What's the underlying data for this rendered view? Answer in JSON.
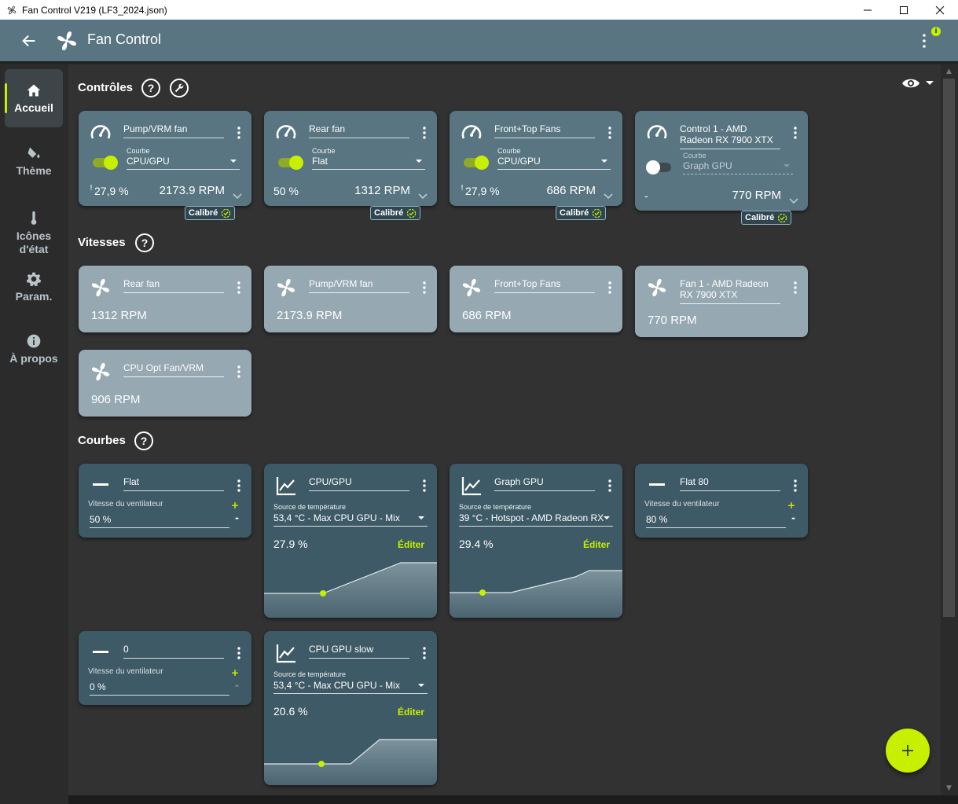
{
  "window": {
    "title": "Fan Control V219 (LF3_2024.json)"
  },
  "appbar": {
    "title": "Fan Control",
    "info_badge": "i"
  },
  "sidebar": {
    "items": [
      {
        "label": "Accueil",
        "icon": "home-icon",
        "active": true
      },
      {
        "label": "Thème",
        "icon": "paint-bucket-icon",
        "active": false
      },
      {
        "label": "Icônes d'état",
        "icon": "thermometer-icon",
        "active": false
      },
      {
        "label": "Param.",
        "icon": "gear-icon",
        "active": false
      },
      {
        "label": "À propos",
        "icon": "info-icon",
        "active": false
      }
    ]
  },
  "sections": {
    "controls": "Contrôles",
    "speeds": "Vitesses",
    "curves": "Courbes",
    "help_symbol": "?"
  },
  "controls": [
    {
      "name": "Pump/VRM fan",
      "curve_label": "Courbe",
      "curve": "CPU/GPU",
      "enabled": true,
      "percent": "27,9 %",
      "warning": "!",
      "rpm": "2173.9 RPM",
      "badge": "Calibré"
    },
    {
      "name": "Rear fan",
      "curve_label": "Courbe",
      "curve": "Flat",
      "enabled": true,
      "percent": "50 %",
      "warning": "",
      "rpm": "1312 RPM",
      "badge": "Calibré"
    },
    {
      "name": "Front+Top Fans",
      "curve_label": "Courbe",
      "curve": "CPU/GPU",
      "enabled": true,
      "percent": "27,9 %",
      "warning": "!",
      "rpm": "686 RPM",
      "badge": "Calibré"
    },
    {
      "name": "Control 1 - AMD Radeon RX 7900 XTX",
      "curve_label": "Courbe",
      "curve": "Graph GPU",
      "enabled": false,
      "percent": "-",
      "warning": "",
      "rpm": "770 RPM",
      "badge": "Calibré"
    }
  ],
  "speeds": [
    {
      "name": "Rear fan",
      "rpm": "1312 RPM"
    },
    {
      "name": "Pump/VRM fan",
      "rpm": "2173.9 RPM"
    },
    {
      "name": "Front+Top Fans",
      "rpm": "686 RPM"
    },
    {
      "name": "Fan 1 - AMD Radeon RX 7900 XTX",
      "rpm": "770 RPM"
    },
    {
      "name": "CPU Opt Fan/VRM",
      "rpm": "906 RPM"
    }
  ],
  "curves": {
    "flat": {
      "name": "Flat",
      "label": "Vitesse du ventilateur",
      "value": "50 %"
    },
    "cpugpu": {
      "name": "CPU/GPU",
      "source_label": "Source de température",
      "source": "53,4 °C - Max CPU GPU - Mix",
      "percent": "27.9 %",
      "edit": "Éditer"
    },
    "graphgpu": {
      "name": "Graph GPU",
      "source_label": "Source de température",
      "source": "39 °C - Hotspot - AMD Radeon RX",
      "percent": "29.4 %",
      "edit": "Éditer"
    },
    "flat80": {
      "name": "Flat 80",
      "label": "Vitesse du ventilateur",
      "value": "80 %"
    },
    "zero": {
      "name": "0",
      "label": "Vitesse du ventilateur",
      "value": "0 %"
    },
    "cpugpuslow": {
      "name": "CPU GPU slow",
      "source_label": "Source de température",
      "source": "53,4 °C - Max CPU GPU - Mix",
      "percent": "20.6 %",
      "edit": "Éditer"
    },
    "plus": "+",
    "minus": "-"
  },
  "colors": {
    "accent": "#c6f000",
    "header": "#587581",
    "control_card": "#587581",
    "speed_card": "#96a8b1",
    "curve_card": "#3e5a66"
  }
}
